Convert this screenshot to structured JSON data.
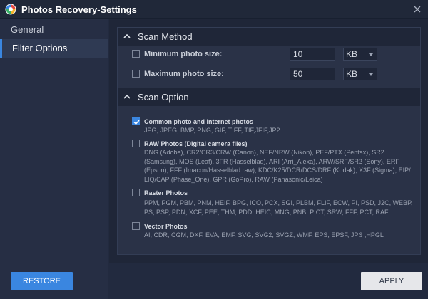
{
  "window": {
    "title": "Photos Recovery-Settings",
    "logo_icon": "app-logo-icon",
    "close_icon": "close-icon"
  },
  "sidebar": {
    "items": [
      {
        "label": "General",
        "active": false
      },
      {
        "label": "Filter Options",
        "active": true
      }
    ]
  },
  "scan_method": {
    "title": "Scan Method",
    "min": {
      "label": "Minimum photo size:",
      "value": "10",
      "unit": "KB",
      "checked": false
    },
    "max": {
      "label": "Maximum photo size:",
      "value": "50",
      "unit": "KB",
      "checked": false
    }
  },
  "scan_option": {
    "title": "Scan Option",
    "options": [
      {
        "title": "Common photo and internet photos",
        "checked": true,
        "lines": [
          "JPG, JPEG, BMP, PNG, GIF, TIFF, TIF,JFIF,JP2"
        ]
      },
      {
        "title": "RAW Photos (Digital camera files)",
        "checked": false,
        "lines": [
          "DNG (Adobe), CR2/CR3/CRW (Canon), NEF/NRW (Nikon), PEF/PTX (Pentax), SR2",
          "(Samsung), MOS (Leaf), 3FR (Hasselblad), ARI (Arri_Alexa), ARW/SRF/SR2 (Sony), ERF",
          "(Epson), FFF (Imacon/Hasselblad raw), KDC/K25/DCR/DCS/DRF (Kodak), X3F (Sigma), EIP/",
          "LIQ/CAP (Phase_One), GPR (GoPro), RAW (Panasonic/Leica)"
        ]
      },
      {
        "title": "Raster Photos",
        "checked": false,
        "lines": [
          "PPM, PGM, PBM, PNM, HEIF, BPG, ICO, PCX, SGI, PLBM, FLIF, ECW, PI, PSD, J2C, WEBP,",
          "PS, PSP, PDN, XCF, PEE, THM, PDD, HEIC, MNG, PNB, PICT, SRW, FFF, PCT, RAF"
        ]
      },
      {
        "title": "Vector Photos",
        "checked": false,
        "lines": [
          "AI, CDR, CGM, DXF, EVA, EMF, SVG, SVG2, SVGZ, WMF, EPS, EPSF, JPS ,HPGL"
        ]
      }
    ]
  },
  "buttons": {
    "restore": "RESTORE",
    "apply": "APPLY"
  },
  "colors": {
    "accent": "#3a86e0",
    "background": "#222a3f",
    "panel": "#2a3247"
  }
}
